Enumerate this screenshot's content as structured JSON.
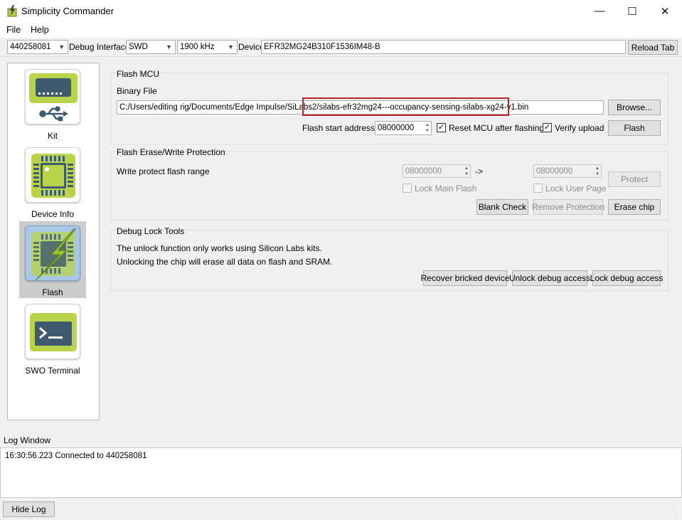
{
  "window": {
    "title": "Simplicity Commander",
    "minimize": "—",
    "maximize": "☐",
    "close": "✕"
  },
  "menu": {
    "file": "File",
    "help": "Help"
  },
  "toolbar": {
    "adapter": "440258081",
    "debug_interface_label": "Debug Interface",
    "debug_interface": "SWD",
    "speed": "1900 kHz",
    "device_label": "Device",
    "device": "EFR32MG24B310F1536IM48-B",
    "reload_tab": "Reload Tab"
  },
  "sidebar": {
    "items": [
      {
        "label": "Kit"
      },
      {
        "label": "Device Info"
      },
      {
        "label": "Flash"
      },
      {
        "label": "SWO Terminal"
      }
    ]
  },
  "flash_mcu": {
    "title": "Flash MCU",
    "binary_file_label": "Binary File",
    "binary_path_prefix": "C:/Users/editing rig/Documents/Edge Impulse/SiLabs2/",
    "binary_file_name": "silabs-efr32mg24---occupancy-sensing-silabs-xg24-v1.bin",
    "browse": "Browse...",
    "start_address_label": "Flash start address:",
    "start_address": "08000000",
    "reset_label": "Reset MCU after flashing",
    "reset_checked": "✓",
    "verify_label": "Verify upload",
    "verify_checked": "✓",
    "flash_button": "Flash"
  },
  "protection": {
    "title": "Flash Erase/Write Protection",
    "range_label": "Write protect flash range",
    "range_start": "08000000",
    "arrow": "->",
    "range_end": "08000000",
    "protect": "Protect",
    "lock_main_flash": "Lock Main Flash",
    "lock_user_page": "Lock User Page",
    "blank_check": "Blank Check",
    "remove_protection": "Remove Protection",
    "erase_chip": "Erase chip"
  },
  "debug_lock": {
    "title": "Debug Lock Tools",
    "line1": "The unlock function only works using Silicon Labs kits.",
    "line2": "Unlocking the chip will erase all data on flash and SRAM.",
    "recover": "Recover bricked device",
    "unlock": "Unlock debug access",
    "lock": "Lock debug access"
  },
  "log": {
    "title": "Log Window",
    "entry": "16:30:56.223 Connected to 440258081",
    "hide_log": "Hide Log"
  },
  "colors": {
    "highlight_box": "#c0252b",
    "tile_green": "#b9d34a",
    "selected_bg": "#cccccc"
  }
}
